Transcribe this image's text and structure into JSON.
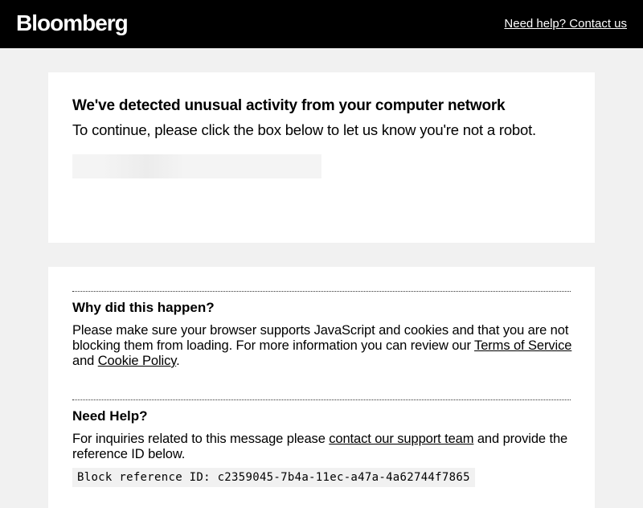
{
  "header": {
    "logo_text": "Bloomberg",
    "help_link": "Need help? Contact us"
  },
  "challenge": {
    "title": "We've detected unusual activity from your computer network",
    "subtitle": "To continue, please click the box below to let us know you're not a robot."
  },
  "why": {
    "title": "Why did this happen?",
    "text_before": "Please make sure your browser supports JavaScript and cookies and that you are not blocking them from loading. For more information you can review our ",
    "terms_link": "Terms of Service",
    "text_and": " and ",
    "cookie_link": "Cookie Policy",
    "text_end": "."
  },
  "help": {
    "title": "Need Help?",
    "text_before": "For inquiries related to this message please ",
    "support_link": "contact our support team",
    "text_after": " and provide the reference ID below.",
    "reference_label": "Block reference ID: c2359045-7b4a-11ec-a47a-4a62744f7865"
  },
  "colors": {
    "header_bg": "#000000",
    "page_bg": "#f1f1f1",
    "card_bg": "#ffffff"
  }
}
